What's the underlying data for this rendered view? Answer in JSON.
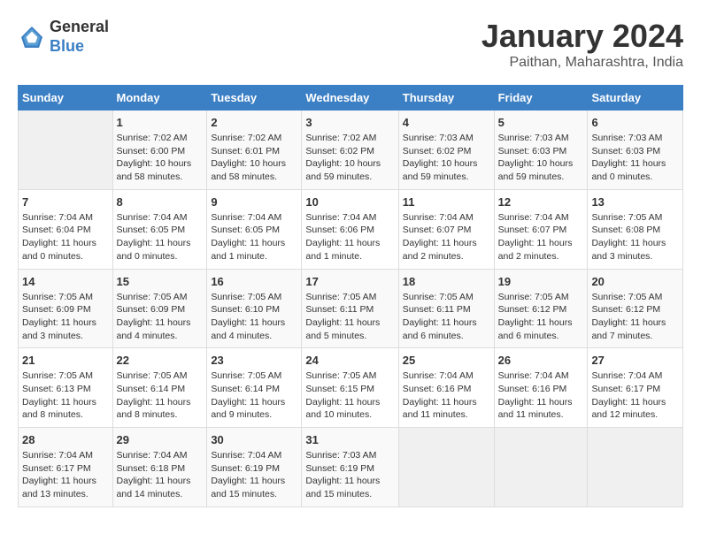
{
  "header": {
    "logo_general": "General",
    "logo_blue": "Blue",
    "month_year": "January 2024",
    "location": "Paithan, Maharashtra, India"
  },
  "days_of_week": [
    "Sunday",
    "Monday",
    "Tuesday",
    "Wednesday",
    "Thursday",
    "Friday",
    "Saturday"
  ],
  "weeks": [
    [
      {
        "day": "",
        "info": ""
      },
      {
        "day": "1",
        "info": "Sunrise: 7:02 AM\nSunset: 6:00 PM\nDaylight: 10 hours\nand 58 minutes."
      },
      {
        "day": "2",
        "info": "Sunrise: 7:02 AM\nSunset: 6:01 PM\nDaylight: 10 hours\nand 58 minutes."
      },
      {
        "day": "3",
        "info": "Sunrise: 7:02 AM\nSunset: 6:02 PM\nDaylight: 10 hours\nand 59 minutes."
      },
      {
        "day": "4",
        "info": "Sunrise: 7:03 AM\nSunset: 6:02 PM\nDaylight: 10 hours\nand 59 minutes."
      },
      {
        "day": "5",
        "info": "Sunrise: 7:03 AM\nSunset: 6:03 PM\nDaylight: 10 hours\nand 59 minutes."
      },
      {
        "day": "6",
        "info": "Sunrise: 7:03 AM\nSunset: 6:03 PM\nDaylight: 11 hours\nand 0 minutes."
      }
    ],
    [
      {
        "day": "7",
        "info": "Sunrise: 7:04 AM\nSunset: 6:04 PM\nDaylight: 11 hours\nand 0 minutes."
      },
      {
        "day": "8",
        "info": "Sunrise: 7:04 AM\nSunset: 6:05 PM\nDaylight: 11 hours\nand 0 minutes."
      },
      {
        "day": "9",
        "info": "Sunrise: 7:04 AM\nSunset: 6:05 PM\nDaylight: 11 hours\nand 1 minute."
      },
      {
        "day": "10",
        "info": "Sunrise: 7:04 AM\nSunset: 6:06 PM\nDaylight: 11 hours\nand 1 minute."
      },
      {
        "day": "11",
        "info": "Sunrise: 7:04 AM\nSunset: 6:07 PM\nDaylight: 11 hours\nand 2 minutes."
      },
      {
        "day": "12",
        "info": "Sunrise: 7:04 AM\nSunset: 6:07 PM\nDaylight: 11 hours\nand 2 minutes."
      },
      {
        "day": "13",
        "info": "Sunrise: 7:05 AM\nSunset: 6:08 PM\nDaylight: 11 hours\nand 3 minutes."
      }
    ],
    [
      {
        "day": "14",
        "info": "Sunrise: 7:05 AM\nSunset: 6:09 PM\nDaylight: 11 hours\nand 3 minutes."
      },
      {
        "day": "15",
        "info": "Sunrise: 7:05 AM\nSunset: 6:09 PM\nDaylight: 11 hours\nand 4 minutes."
      },
      {
        "day": "16",
        "info": "Sunrise: 7:05 AM\nSunset: 6:10 PM\nDaylight: 11 hours\nand 4 minutes."
      },
      {
        "day": "17",
        "info": "Sunrise: 7:05 AM\nSunset: 6:11 PM\nDaylight: 11 hours\nand 5 minutes."
      },
      {
        "day": "18",
        "info": "Sunrise: 7:05 AM\nSunset: 6:11 PM\nDaylight: 11 hours\nand 6 minutes."
      },
      {
        "day": "19",
        "info": "Sunrise: 7:05 AM\nSunset: 6:12 PM\nDaylight: 11 hours\nand 6 minutes."
      },
      {
        "day": "20",
        "info": "Sunrise: 7:05 AM\nSunset: 6:12 PM\nDaylight: 11 hours\nand 7 minutes."
      }
    ],
    [
      {
        "day": "21",
        "info": "Sunrise: 7:05 AM\nSunset: 6:13 PM\nDaylight: 11 hours\nand 8 minutes."
      },
      {
        "day": "22",
        "info": "Sunrise: 7:05 AM\nSunset: 6:14 PM\nDaylight: 11 hours\nand 8 minutes."
      },
      {
        "day": "23",
        "info": "Sunrise: 7:05 AM\nSunset: 6:14 PM\nDaylight: 11 hours\nand 9 minutes."
      },
      {
        "day": "24",
        "info": "Sunrise: 7:05 AM\nSunset: 6:15 PM\nDaylight: 11 hours\nand 10 minutes."
      },
      {
        "day": "25",
        "info": "Sunrise: 7:04 AM\nSunset: 6:16 PM\nDaylight: 11 hours\nand 11 minutes."
      },
      {
        "day": "26",
        "info": "Sunrise: 7:04 AM\nSunset: 6:16 PM\nDaylight: 11 hours\nand 11 minutes."
      },
      {
        "day": "27",
        "info": "Sunrise: 7:04 AM\nSunset: 6:17 PM\nDaylight: 11 hours\nand 12 minutes."
      }
    ],
    [
      {
        "day": "28",
        "info": "Sunrise: 7:04 AM\nSunset: 6:17 PM\nDaylight: 11 hours\nand 13 minutes."
      },
      {
        "day": "29",
        "info": "Sunrise: 7:04 AM\nSunset: 6:18 PM\nDaylight: 11 hours\nand 14 minutes."
      },
      {
        "day": "30",
        "info": "Sunrise: 7:04 AM\nSunset: 6:19 PM\nDaylight: 11 hours\nand 15 minutes."
      },
      {
        "day": "31",
        "info": "Sunrise: 7:03 AM\nSunset: 6:19 PM\nDaylight: 11 hours\nand 15 minutes."
      },
      {
        "day": "",
        "info": ""
      },
      {
        "day": "",
        "info": ""
      },
      {
        "day": "",
        "info": ""
      }
    ]
  ]
}
